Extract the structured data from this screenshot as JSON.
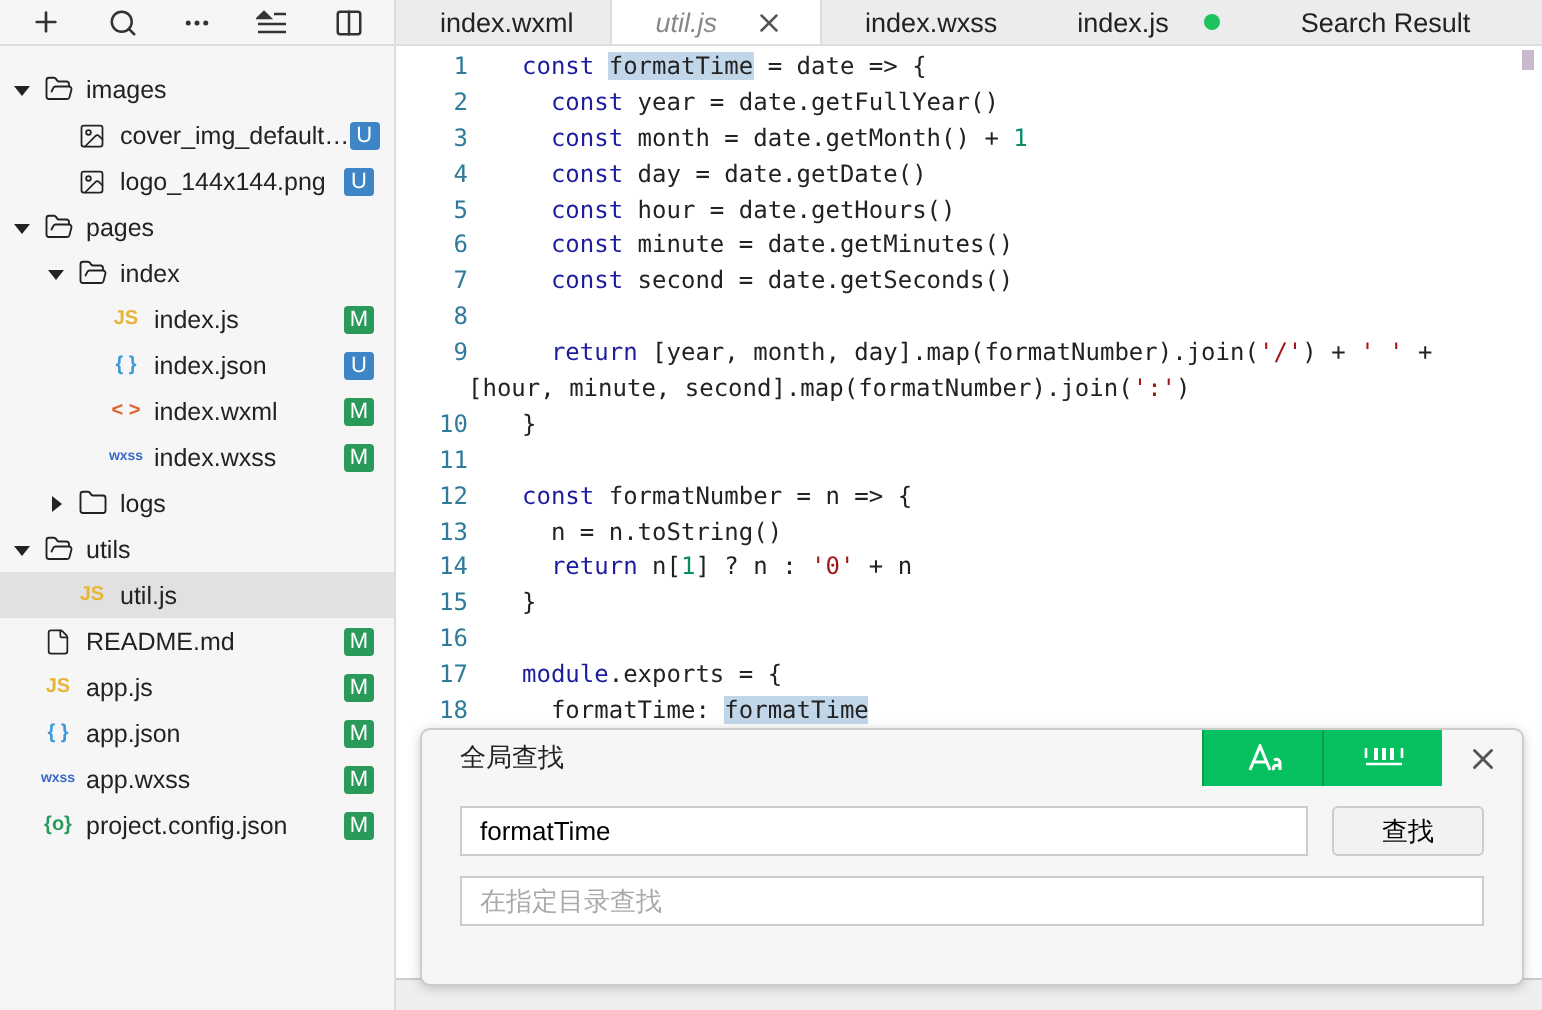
{
  "tree": [
    {
      "kind": "folder",
      "name": "images",
      "expanded": true,
      "selected": false,
      "children": [
        {
          "kind": "image",
          "name": "cover_img_default…",
          "badge": "U",
          "color": "#3d85c6",
          "selected": false
        },
        {
          "kind": "image",
          "name": "logo_144x144.png",
          "badge": "U",
          "color": "#3d85c6",
          "selected": false
        }
      ]
    },
    {
      "kind": "folder",
      "name": "pages",
      "expanded": true,
      "selected": false,
      "children": [
        {
          "kind": "folder",
          "name": "index",
          "expanded": true,
          "selected": false,
          "children": [
            {
              "kind": "js",
              "glyph": "JS",
              "name": "index.js",
              "badge": "M",
              "color": "#2a9a5a",
              "selected": false
            },
            {
              "kind": "json",
              "glyph": "{ }",
              "name": "index.json",
              "badge": "U",
              "color": "#3d85c6",
              "selected": false
            },
            {
              "kind": "wxml",
              "glyph": "< >",
              "name": "index.wxml",
              "badge": "M",
              "color": "#2a9a5a",
              "selected": false
            },
            {
              "kind": "wxss",
              "glyph": "wxss",
              "name": "index.wxss",
              "badge": "M",
              "color": "#2a9a5a",
              "selected": false
            }
          ]
        },
        {
          "kind": "folder",
          "name": "logs",
          "expanded": false,
          "selected": false
        }
      ]
    },
    {
      "kind": "folder",
      "name": "utils",
      "expanded": true,
      "selected": false,
      "children": [
        {
          "kind": "js",
          "glyph": "JS",
          "name": "util.js",
          "selected": true
        }
      ]
    },
    {
      "kind": "file",
      "name": "README.md",
      "badge": "M",
      "color": "#2a9a5a",
      "selected": false
    },
    {
      "kind": "js",
      "glyph": "JS",
      "name": "app.js",
      "badge": "M",
      "color": "#2a9a5a",
      "selected": false
    },
    {
      "kind": "json",
      "glyph": "{ }",
      "name": "app.json",
      "badge": "M",
      "color": "#2a9a5a",
      "selected": false
    },
    {
      "kind": "wxss",
      "glyph": "wxss",
      "name": "app.wxss",
      "badge": "M",
      "color": "#2a9a5a",
      "selected": false
    },
    {
      "kind": "config",
      "glyph": "{o}",
      "name": "project.config.json",
      "badge": "M",
      "color": "#2a9a5a",
      "selected": false
    }
  ],
  "tabs": [
    {
      "label": "index.wxml",
      "selected": false,
      "preview": false,
      "modified": false
    },
    {
      "label": "util.js",
      "selected": true,
      "preview": true,
      "modified": false
    },
    {
      "label": "index.wxss",
      "selected": false,
      "preview": false,
      "modified": false
    },
    {
      "label": "index.js",
      "selected": false,
      "preview": false,
      "modified": true
    },
    {
      "label": "Search Result",
      "selected": false,
      "preview": false,
      "modified": false
    }
  ],
  "code": [
    {
      "number": "1",
      "tokens": [
        {
          "text": "const ",
          "kind": "keyword"
        },
        {
          "text": "formatTime",
          "kind": "match"
        },
        {
          "text": " = date => {",
          "kind": "plain"
        }
      ]
    },
    {
      "number": "2",
      "tokens": [
        {
          "text": "  const",
          "kind": "keyword"
        },
        {
          "text": " year = date.getFullYear()",
          "kind": "plain"
        }
      ]
    },
    {
      "number": "3",
      "tokens": [
        {
          "text": "  const",
          "kind": "keyword"
        },
        {
          "text": " month = date.getMonth() + ",
          "kind": "plain"
        },
        {
          "text": "1",
          "kind": "number"
        }
      ]
    },
    {
      "number": "4",
      "tokens": [
        {
          "text": "  const",
          "kind": "keyword"
        },
        {
          "text": " day = date.getDate()",
          "kind": "plain"
        }
      ]
    },
    {
      "number": "5",
      "tokens": [
        {
          "text": "  const",
          "kind": "keyword"
        },
        {
          "text": " hour = date.getHours()",
          "kind": "plain"
        }
      ]
    },
    {
      "number": "6",
      "tokens": [
        {
          "text": "  const",
          "kind": "keyword"
        },
        {
          "text": " minute = date.getMinutes()",
          "kind": "plain"
        }
      ]
    },
    {
      "number": "7",
      "tokens": [
        {
          "text": "  const",
          "kind": "keyword"
        },
        {
          "text": " second = date.getSeconds()",
          "kind": "plain"
        }
      ]
    },
    {
      "number": "8"
    },
    {
      "number": "9",
      "tokens": [
        {
          "text": "  return",
          "kind": "keyword"
        },
        {
          "text": " [year, month, day].map(formatNumber).join(",
          "kind": "plain"
        },
        {
          "text": "'/'",
          "kind": "string"
        },
        {
          "text": ") + ",
          "kind": "plain"
        },
        {
          "text": "' '",
          "kind": "string"
        },
        {
          "text": " +",
          "kind": "plain"
        }
      ],
      "continuation": [
        {
          "text": "[hour, minute, second].map(formatNumber).join(",
          "kind": "plain"
        },
        {
          "text": "':'",
          "kind": "string"
        },
        {
          "text": ")",
          "kind": "plain"
        }
      ]
    },
    {
      "number": "10",
      "tokens": [
        {
          "text": "}",
          "kind": "plain"
        }
      ]
    },
    {
      "number": "11"
    },
    {
      "number": "12",
      "tokens": [
        {
          "text": "const",
          "kind": "keyword"
        },
        {
          "text": " formatNumber = n => {",
          "kind": "plain"
        }
      ]
    },
    {
      "number": "13",
      "tokens": [
        {
          "text": "  n = n.toString()",
          "kind": "plain"
        }
      ]
    },
    {
      "number": "14",
      "tokens": [
        {
          "text": "  return",
          "kind": "keyword"
        },
        {
          "text": " n[",
          "kind": "plain"
        },
        {
          "text": "1",
          "kind": "number"
        },
        {
          "text": "] ? n : ",
          "kind": "plain"
        },
        {
          "text": "'0'",
          "kind": "string"
        },
        {
          "text": " + n",
          "kind": "plain"
        }
      ]
    },
    {
      "number": "15",
      "tokens": [
        {
          "text": "}",
          "kind": "plain"
        }
      ]
    },
    {
      "number": "16"
    },
    {
      "number": "17",
      "tokens": [
        {
          "text": "module",
          "kind": "keyword"
        },
        {
          "text": ".exports = {",
          "kind": "plain"
        }
      ]
    },
    {
      "number": "18",
      "tokens": [
        {
          "text": "  formatTime: ",
          "kind": "plain"
        },
        {
          "text": "formatTime",
          "kind": "match"
        }
      ]
    }
  ],
  "search_dialog": {
    "title": "全局查找",
    "match_case": true,
    "whole_word": true,
    "query": "formatTime",
    "find_button": "查找",
    "directory_placeholder": "在指定目录查找"
  }
}
